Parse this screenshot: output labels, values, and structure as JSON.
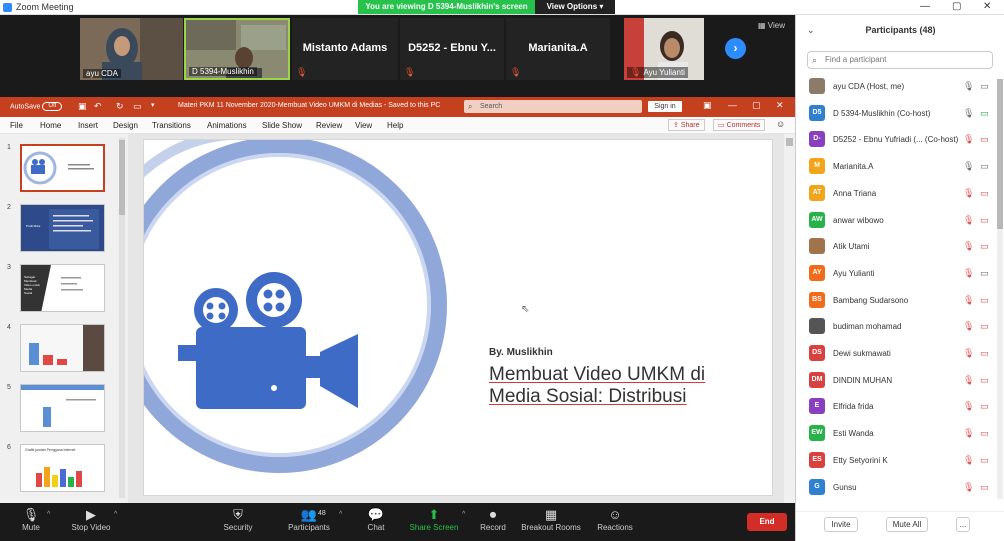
{
  "window": {
    "title": "Zoom Meeting",
    "viewing_banner": "You are viewing D 5394-Muslikhin's screen",
    "view_options": "View Options",
    "minimize": "—",
    "maximize": "▢",
    "close": "✕"
  },
  "strip": {
    "tiles": [
      {
        "name": "ayu CDA",
        "type": "video"
      },
      {
        "name": "D 5394-Muslikhin",
        "type": "video"
      },
      {
        "name": "Mistanto Adams",
        "type": "name"
      },
      {
        "name": "D5252 - Ebnu Y...",
        "type": "name"
      },
      {
        "name": "Marianita.A",
        "type": "name"
      },
      {
        "name": "Ayu Yulianti",
        "type": "video"
      }
    ],
    "mute_glyph": "🎙",
    "next_arrow": "›",
    "view_label": "View"
  },
  "ppt": {
    "autosave": "AutoSave",
    "autosave_state": "Off",
    "doc_title": "Materi PKM 11 November 2020-Membuat Video UMKM di Medias  -  Saved to this PC",
    "search_placeholder": "Search",
    "signin": "Sign in",
    "menu": [
      "File",
      "Home",
      "Insert",
      "Design",
      "Transitions",
      "Animations",
      "Slide Show",
      "Review",
      "View",
      "Help"
    ],
    "share": "Share",
    "comments": "Comments",
    "thumb_numbers": [
      "1",
      "2",
      "3",
      "4",
      "5",
      "6"
    ],
    "thumb_texts": {
      "t2": "Profil Mitra",
      "t3": "Sebagai Membuat Video untuk Media Sosial",
      "t6": "Grafik jumlah Pengguna Internet"
    },
    "slide": {
      "byline": "By. Muslikhin",
      "title_line1": "Membuat Video UMKM di",
      "title_line2": "Media Sosial: Distribusi"
    }
  },
  "controls": {
    "mute": "Mute",
    "stop_video": "Stop Video",
    "security": "Security",
    "participants": "Participants",
    "participants_count": "48",
    "chat": "Chat",
    "share_screen": "Share Screen",
    "record": "Record",
    "breakout": "Breakout Rooms",
    "reactions": "Reactions",
    "end": "End"
  },
  "panel": {
    "title": "Participants (48)",
    "search_placeholder": "Find a participant",
    "participants": [
      {
        "initials": "",
        "name": "ayu CDA (Host, me)",
        "color": "#8d7b6a",
        "mic": "on",
        "cam": "off_plain"
      },
      {
        "initials": "D5",
        "name": "D 5394-Muslikhin (Co-host)",
        "color": "#2f80d1",
        "mic": "on",
        "cam": "on"
      },
      {
        "initials": "D-",
        "name": "D5252 - Ebnu Yufriadi (... (Co-host)",
        "color": "#8a3fbf",
        "mic": "muted",
        "cam": "muted"
      },
      {
        "initials": "M",
        "name": "Marianita.A",
        "color": "#f2a51a",
        "mic": "on",
        "cam": "off_plain"
      },
      {
        "initials": "AT",
        "name": "Anna Triana",
        "color": "#f2a51a",
        "mic": "muted",
        "cam": "muted"
      },
      {
        "initials": "AW",
        "name": "anwar wibowo",
        "color": "#27b24a",
        "mic": "muted",
        "cam": "muted"
      },
      {
        "initials": "",
        "name": "Atik Utami",
        "color": "#a0734b",
        "mic": "muted",
        "cam": "muted"
      },
      {
        "initials": "AY",
        "name": "Ayu Yulianti",
        "color": "#f06b1a",
        "mic": "muted",
        "cam": "off_plain"
      },
      {
        "initials": "BS",
        "name": "Bambang Sudarsono",
        "color": "#f06b1a",
        "mic": "muted",
        "cam": "muted"
      },
      {
        "initials": "",
        "name": "budiman mohamad",
        "color": "#555555",
        "mic": "muted",
        "cam": "muted"
      },
      {
        "initials": "DS",
        "name": "Dewi sukmawati",
        "color": "#d94040",
        "mic": "muted",
        "cam": "muted"
      },
      {
        "initials": "DM",
        "name": "DINDIN MUHAN",
        "color": "#d94040",
        "mic": "muted",
        "cam": "muted"
      },
      {
        "initials": "E",
        "name": "Elfrida frida",
        "color": "#8a3fbf",
        "mic": "muted",
        "cam": "muted"
      },
      {
        "initials": "EW",
        "name": "Esti Wanda",
        "color": "#27b24a",
        "mic": "muted",
        "cam": "muted"
      },
      {
        "initials": "ES",
        "name": "Etty Setyorini K",
        "color": "#d94040",
        "mic": "muted",
        "cam": "muted"
      },
      {
        "initials": "G",
        "name": "Gunsu",
        "color": "#2f80d1",
        "mic": "muted",
        "cam": "muted"
      }
    ],
    "invite": "Invite",
    "mute_all": "Mute All",
    "more": "..."
  },
  "icons": {
    "mic": "🎙",
    "mic_muted": "🎙",
    "cam": "▭",
    "search": "⌕"
  },
  "colors": {
    "ppt_red": "#c4401e",
    "zoom_blue": "#2d8cff",
    "zoom_green": "#27c24c",
    "end_red": "#d32d27",
    "slide_icon_blue": "#3e6bc6"
  }
}
